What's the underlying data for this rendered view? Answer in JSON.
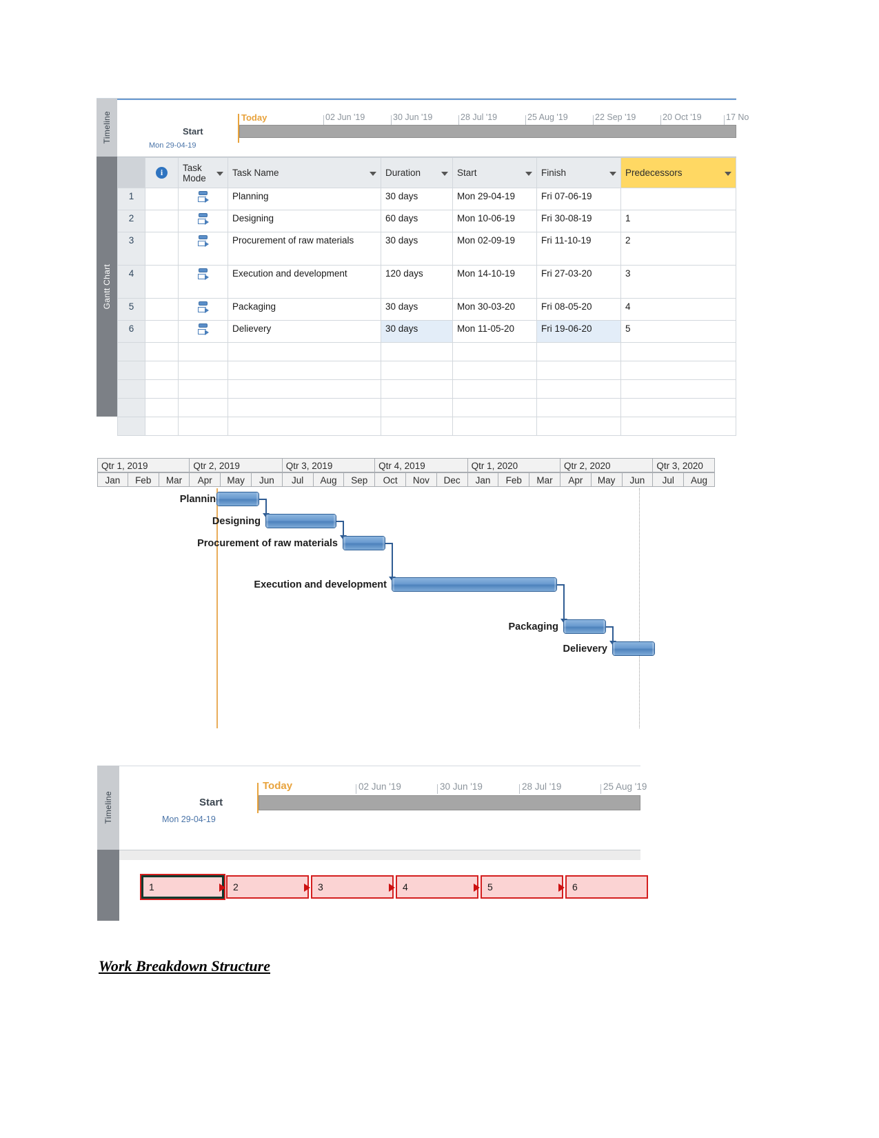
{
  "timeline_top": {
    "panel_label": "Timeline",
    "today_label": "Today",
    "start_label": "Start",
    "start_date": "Mon 29-04-19",
    "ticks": [
      "02 Jun '19",
      "30 Jun '19",
      "28 Jul '19",
      "25 Aug '19",
      "22 Sep '19",
      "20 Oct '19",
      "17 No"
    ]
  },
  "gantt_panel_label": "Gantt Chart",
  "table": {
    "columns": [
      {
        "key": "id",
        "label": ""
      },
      {
        "key": "info",
        "label": "",
        "icon": "information-icon"
      },
      {
        "key": "task_mode",
        "label": "Task Mode"
      },
      {
        "key": "task_name",
        "label": "Task Name"
      },
      {
        "key": "duration",
        "label": "Duration"
      },
      {
        "key": "start",
        "label": "Start"
      },
      {
        "key": "finish",
        "label": "Finish"
      },
      {
        "key": "predecessors",
        "label": "Predecessors",
        "highlight": "#ffd863"
      }
    ],
    "rows": [
      {
        "id": "1",
        "task_name": "Planning",
        "duration": "30 days",
        "start": "Mon 29-04-19",
        "finish": "Fri 07-06-19",
        "predecessors": ""
      },
      {
        "id": "2",
        "task_name": "Designing",
        "duration": "60 days",
        "start": "Mon 10-06-19",
        "finish": "Fri 30-08-19",
        "predecessors": "1"
      },
      {
        "id": "3",
        "task_name": "Procurement of raw materials",
        "duration": "30 days",
        "start": "Mon 02-09-19",
        "finish": "Fri 11-10-19",
        "predecessors": "2"
      },
      {
        "id": "4",
        "task_name": "Execution and development",
        "duration": "120 days",
        "start": "Mon 14-10-19",
        "finish": "Fri 27-03-20",
        "predecessors": "3"
      },
      {
        "id": "5",
        "task_name": "Packaging",
        "duration": "30 days",
        "start": "Mon 30-03-20",
        "finish": "Fri 08-05-20",
        "predecessors": "4"
      },
      {
        "id": "6",
        "task_name": "Delievery",
        "duration": "30 days",
        "start": "Mon 11-05-20",
        "finish": "Fri 19-06-20",
        "predecessors": "5"
      }
    ],
    "empty_row_count": 5
  },
  "chart_data": {
    "type": "bar",
    "title": "",
    "orientation": "horizontal-gantt",
    "xlabel": "",
    "ylabel": "",
    "quarters": [
      "Qtr 1, 2019",
      "Qtr 2, 2019",
      "Qtr 3, 2019",
      "Qtr 4, 2019",
      "Qtr 1, 2020",
      "Qtr 2, 2020",
      "Qtr 3, 2020"
    ],
    "months": [
      "Jan",
      "Feb",
      "Mar",
      "Apr",
      "May",
      "Jun",
      "Jul",
      "Aug",
      "Sep",
      "Oct",
      "Nov",
      "Dec",
      "Jan",
      "Feb",
      "Mar",
      "Apr",
      "May",
      "Jun",
      "Jul",
      "Aug"
    ],
    "axis_start": "2019-01",
    "axis_end": "2020-09",
    "today_marker": "2019-04-29",
    "tasks": [
      {
        "name": "Planning",
        "start": "Mon 29-04-19",
        "finish": "Fri 07-06-19",
        "duration_days": 30,
        "predecessor": ""
      },
      {
        "name": "Designing",
        "start": "Mon 10-06-19",
        "finish": "Fri 30-08-19",
        "duration_days": 60,
        "predecessor": "Planning"
      },
      {
        "name": "Procurement of raw materials",
        "start": "Mon 02-09-19",
        "finish": "Fri 11-10-19",
        "duration_days": 30,
        "predecessor": "Designing"
      },
      {
        "name": "Execution and development",
        "start": "Mon 14-10-19",
        "finish": "Fri 27-03-20",
        "duration_days": 120,
        "predecessor": "Procurement of raw materials"
      },
      {
        "name": "Packaging",
        "start": "Mon 30-03-20",
        "finish": "Fri 08-05-20",
        "duration_days": 30,
        "predecessor": "Execution and development"
      },
      {
        "name": "Delievery",
        "start": "Mon 11-05-20",
        "finish": "Fri 19-06-20",
        "duration_days": 30,
        "predecessor": "Packaging"
      }
    ],
    "grid": false,
    "legend": "none"
  },
  "timeline_bottom": {
    "panel_label": "Timeline",
    "today_label": "Today",
    "start_label": "Start",
    "start_date": "Mon 29-04-19",
    "ticks": [
      "02 Jun '19",
      "30 Jun '19",
      "28 Jul '19",
      "25 Aug '19"
    ]
  },
  "network_diagram": {
    "nodes": [
      "1",
      "2",
      "3",
      "4",
      "5",
      "6"
    ]
  },
  "caption": "Work Breakdown Structure",
  "colors": {
    "accent_orange": "#e8a33d",
    "predecessor_header": "#ffd863",
    "bar_blue": "#4d82bd",
    "network_red": "#cc1111",
    "network_fill": "#fbd3d3",
    "timeline_bar_gray": "#a6a6a6"
  }
}
